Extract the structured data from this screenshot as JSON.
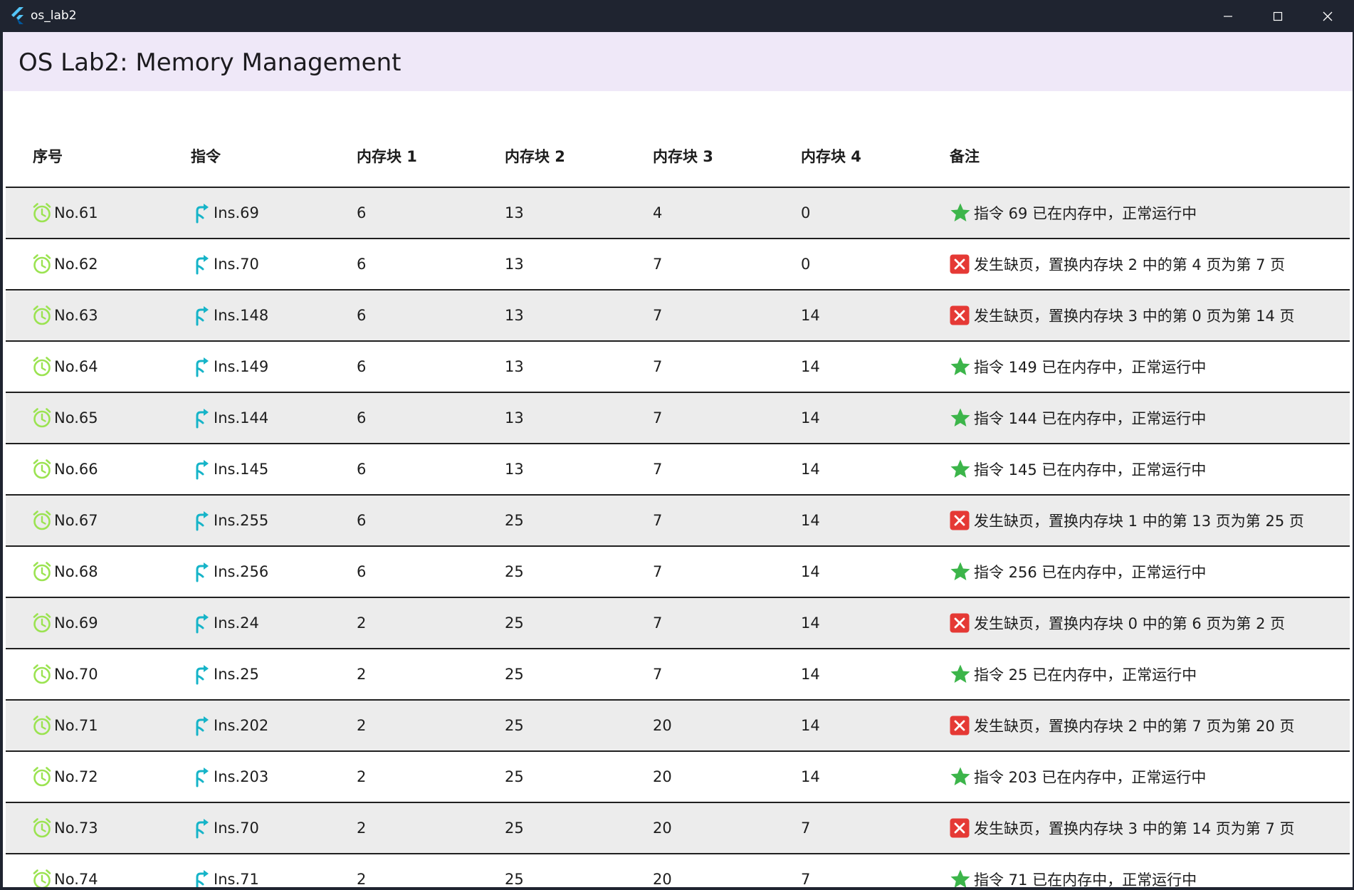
{
  "window": {
    "title": "os_lab2"
  },
  "appbar": {
    "title": "OS Lab2: Memory Management",
    "background": "#efe8f8"
  },
  "colors": {
    "clock_icon": "#9be351",
    "branch_icon": "#16b4c8",
    "star_icon": "#3cb54a",
    "fault_icon": "#e53935",
    "row_shade": "#ececec",
    "titlebar": "#1f2430"
  },
  "table": {
    "headers": [
      "序号",
      "指令",
      "内存块 1",
      "内存块 2",
      "内存块 3",
      "内存块 4",
      "备注"
    ],
    "rows": [
      {
        "no": "No.61",
        "ins": "Ins.69",
        "b1": "6",
        "b2": "13",
        "b3": "4",
        "b4": "0",
        "status": "hit",
        "note": "指令 69 已在内存中，正常运行中"
      },
      {
        "no": "No.62",
        "ins": "Ins.70",
        "b1": "6",
        "b2": "13",
        "b3": "7",
        "b4": "0",
        "status": "fault",
        "note": "发生缺页，置换内存块 2 中的第 4 页为第 7 页"
      },
      {
        "no": "No.63",
        "ins": "Ins.148",
        "b1": "6",
        "b2": "13",
        "b3": "7",
        "b4": "14",
        "status": "fault",
        "note": "发生缺页，置换内存块 3 中的第 0 页为第 14 页"
      },
      {
        "no": "No.64",
        "ins": "Ins.149",
        "b1": "6",
        "b2": "13",
        "b3": "7",
        "b4": "14",
        "status": "hit",
        "note": "指令 149 已在内存中，正常运行中"
      },
      {
        "no": "No.65",
        "ins": "Ins.144",
        "b1": "6",
        "b2": "13",
        "b3": "7",
        "b4": "14",
        "status": "hit",
        "note": "指令 144 已在内存中，正常运行中"
      },
      {
        "no": "No.66",
        "ins": "Ins.145",
        "b1": "6",
        "b2": "13",
        "b3": "7",
        "b4": "14",
        "status": "hit",
        "note": "指令 145 已在内存中，正常运行中"
      },
      {
        "no": "No.67",
        "ins": "Ins.255",
        "b1": "6",
        "b2": "25",
        "b3": "7",
        "b4": "14",
        "status": "fault",
        "note": "发生缺页，置换内存块 1 中的第 13 页为第 25 页"
      },
      {
        "no": "No.68",
        "ins": "Ins.256",
        "b1": "6",
        "b2": "25",
        "b3": "7",
        "b4": "14",
        "status": "hit",
        "note": "指令 256 已在内存中，正常运行中"
      },
      {
        "no": "No.69",
        "ins": "Ins.24",
        "b1": "2",
        "b2": "25",
        "b3": "7",
        "b4": "14",
        "status": "fault",
        "note": "发生缺页，置换内存块 0 中的第 6 页为第 2 页"
      },
      {
        "no": "No.70",
        "ins": "Ins.25",
        "b1": "2",
        "b2": "25",
        "b3": "7",
        "b4": "14",
        "status": "hit",
        "note": "指令 25 已在内存中，正常运行中"
      },
      {
        "no": "No.71",
        "ins": "Ins.202",
        "b1": "2",
        "b2": "25",
        "b3": "20",
        "b4": "14",
        "status": "fault",
        "note": "发生缺页，置换内存块 2 中的第 7 页为第 20 页"
      },
      {
        "no": "No.72",
        "ins": "Ins.203",
        "b1": "2",
        "b2": "25",
        "b3": "20",
        "b4": "14",
        "status": "hit",
        "note": "指令 203 已在内存中，正常运行中"
      },
      {
        "no": "No.73",
        "ins": "Ins.70",
        "b1": "2",
        "b2": "25",
        "b3": "20",
        "b4": "7",
        "status": "fault",
        "note": "发生缺页，置换内存块 3 中的第 14 页为第 7 页"
      },
      {
        "no": "No.74",
        "ins": "Ins.71",
        "b1": "2",
        "b2": "25",
        "b3": "20",
        "b4": "7",
        "status": "hit",
        "note": "指令 71 已在内存中，正常运行中"
      }
    ]
  }
}
